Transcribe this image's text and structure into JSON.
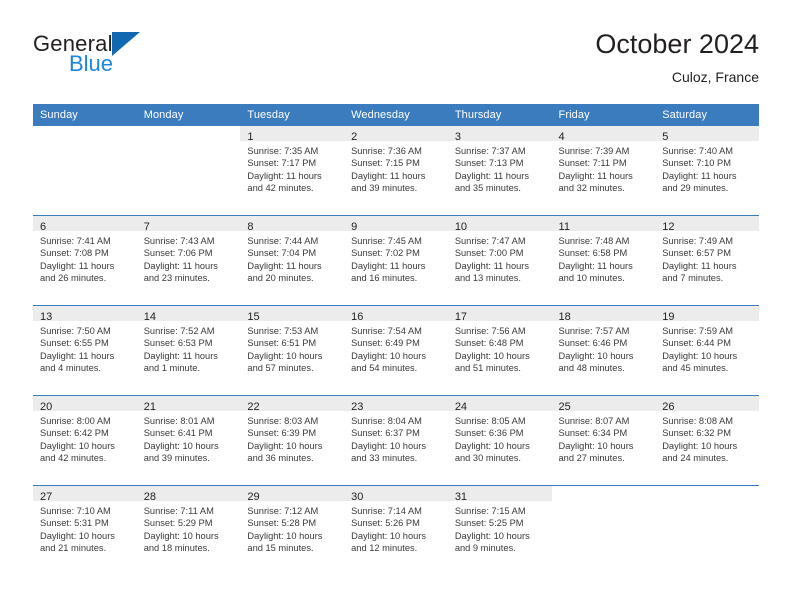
{
  "brand": {
    "name_part1": "General",
    "name_part2": "Blue",
    "triangle_icon": "brand-triangle-icon",
    "accent_color": "#1068b0",
    "blue_color": "#1b86e0"
  },
  "header": {
    "month_title": "October 2024",
    "location": "Culoz, France"
  },
  "theme": {
    "header_band": "#3a7cbe",
    "daynum_band": "#ececec",
    "text": "#231f20"
  },
  "weekday_headers": [
    "Sunday",
    "Monday",
    "Tuesday",
    "Wednesday",
    "Thursday",
    "Friday",
    "Saturday"
  ],
  "weeks": [
    [
      {
        "day": "",
        "empty": true,
        "sunrise": "",
        "sunset": "",
        "daylight_line1": "",
        "daylight_line2": ""
      },
      {
        "day": "",
        "empty": true,
        "sunrise": "",
        "sunset": "",
        "daylight_line1": "",
        "daylight_line2": ""
      },
      {
        "day": "1",
        "empty": false,
        "sunrise": "Sunrise: 7:35 AM",
        "sunset": "Sunset: 7:17 PM",
        "daylight_line1": "Daylight: 11 hours",
        "daylight_line2": "and 42 minutes."
      },
      {
        "day": "2",
        "empty": false,
        "sunrise": "Sunrise: 7:36 AM",
        "sunset": "Sunset: 7:15 PM",
        "daylight_line1": "Daylight: 11 hours",
        "daylight_line2": "and 39 minutes."
      },
      {
        "day": "3",
        "empty": false,
        "sunrise": "Sunrise: 7:37 AM",
        "sunset": "Sunset: 7:13 PM",
        "daylight_line1": "Daylight: 11 hours",
        "daylight_line2": "and 35 minutes."
      },
      {
        "day": "4",
        "empty": false,
        "sunrise": "Sunrise: 7:39 AM",
        "sunset": "Sunset: 7:11 PM",
        "daylight_line1": "Daylight: 11 hours",
        "daylight_line2": "and 32 minutes."
      },
      {
        "day": "5",
        "empty": false,
        "sunrise": "Sunrise: 7:40 AM",
        "sunset": "Sunset: 7:10 PM",
        "daylight_line1": "Daylight: 11 hours",
        "daylight_line2": "and 29 minutes."
      }
    ],
    [
      {
        "day": "6",
        "empty": false,
        "sunrise": "Sunrise: 7:41 AM",
        "sunset": "Sunset: 7:08 PM",
        "daylight_line1": "Daylight: 11 hours",
        "daylight_line2": "and 26 minutes."
      },
      {
        "day": "7",
        "empty": false,
        "sunrise": "Sunrise: 7:43 AM",
        "sunset": "Sunset: 7:06 PM",
        "daylight_line1": "Daylight: 11 hours",
        "daylight_line2": "and 23 minutes."
      },
      {
        "day": "8",
        "empty": false,
        "sunrise": "Sunrise: 7:44 AM",
        "sunset": "Sunset: 7:04 PM",
        "daylight_line1": "Daylight: 11 hours",
        "daylight_line2": "and 20 minutes."
      },
      {
        "day": "9",
        "empty": false,
        "sunrise": "Sunrise: 7:45 AM",
        "sunset": "Sunset: 7:02 PM",
        "daylight_line1": "Daylight: 11 hours",
        "daylight_line2": "and 16 minutes."
      },
      {
        "day": "10",
        "empty": false,
        "sunrise": "Sunrise: 7:47 AM",
        "sunset": "Sunset: 7:00 PM",
        "daylight_line1": "Daylight: 11 hours",
        "daylight_line2": "and 13 minutes."
      },
      {
        "day": "11",
        "empty": false,
        "sunrise": "Sunrise: 7:48 AM",
        "sunset": "Sunset: 6:58 PM",
        "daylight_line1": "Daylight: 11 hours",
        "daylight_line2": "and 10 minutes."
      },
      {
        "day": "12",
        "empty": false,
        "sunrise": "Sunrise: 7:49 AM",
        "sunset": "Sunset: 6:57 PM",
        "daylight_line1": "Daylight: 11 hours",
        "daylight_line2": "and 7 minutes."
      }
    ],
    [
      {
        "day": "13",
        "empty": false,
        "sunrise": "Sunrise: 7:50 AM",
        "sunset": "Sunset: 6:55 PM",
        "daylight_line1": "Daylight: 11 hours",
        "daylight_line2": "and 4 minutes."
      },
      {
        "day": "14",
        "empty": false,
        "sunrise": "Sunrise: 7:52 AM",
        "sunset": "Sunset: 6:53 PM",
        "daylight_line1": "Daylight: 11 hours",
        "daylight_line2": "and 1 minute."
      },
      {
        "day": "15",
        "empty": false,
        "sunrise": "Sunrise: 7:53 AM",
        "sunset": "Sunset: 6:51 PM",
        "daylight_line1": "Daylight: 10 hours",
        "daylight_line2": "and 57 minutes."
      },
      {
        "day": "16",
        "empty": false,
        "sunrise": "Sunrise: 7:54 AM",
        "sunset": "Sunset: 6:49 PM",
        "daylight_line1": "Daylight: 10 hours",
        "daylight_line2": "and 54 minutes."
      },
      {
        "day": "17",
        "empty": false,
        "sunrise": "Sunrise: 7:56 AM",
        "sunset": "Sunset: 6:48 PM",
        "daylight_line1": "Daylight: 10 hours",
        "daylight_line2": "and 51 minutes."
      },
      {
        "day": "18",
        "empty": false,
        "sunrise": "Sunrise: 7:57 AM",
        "sunset": "Sunset: 6:46 PM",
        "daylight_line1": "Daylight: 10 hours",
        "daylight_line2": "and 48 minutes."
      },
      {
        "day": "19",
        "empty": false,
        "sunrise": "Sunrise: 7:59 AM",
        "sunset": "Sunset: 6:44 PM",
        "daylight_line1": "Daylight: 10 hours",
        "daylight_line2": "and 45 minutes."
      }
    ],
    [
      {
        "day": "20",
        "empty": false,
        "sunrise": "Sunrise: 8:00 AM",
        "sunset": "Sunset: 6:42 PM",
        "daylight_line1": "Daylight: 10 hours",
        "daylight_line2": "and 42 minutes."
      },
      {
        "day": "21",
        "empty": false,
        "sunrise": "Sunrise: 8:01 AM",
        "sunset": "Sunset: 6:41 PM",
        "daylight_line1": "Daylight: 10 hours",
        "daylight_line2": "and 39 minutes."
      },
      {
        "day": "22",
        "empty": false,
        "sunrise": "Sunrise: 8:03 AM",
        "sunset": "Sunset: 6:39 PM",
        "daylight_line1": "Daylight: 10 hours",
        "daylight_line2": "and 36 minutes."
      },
      {
        "day": "23",
        "empty": false,
        "sunrise": "Sunrise: 8:04 AM",
        "sunset": "Sunset: 6:37 PM",
        "daylight_line1": "Daylight: 10 hours",
        "daylight_line2": "and 33 minutes."
      },
      {
        "day": "24",
        "empty": false,
        "sunrise": "Sunrise: 8:05 AM",
        "sunset": "Sunset: 6:36 PM",
        "daylight_line1": "Daylight: 10 hours",
        "daylight_line2": "and 30 minutes."
      },
      {
        "day": "25",
        "empty": false,
        "sunrise": "Sunrise: 8:07 AM",
        "sunset": "Sunset: 6:34 PM",
        "daylight_line1": "Daylight: 10 hours",
        "daylight_line2": "and 27 minutes."
      },
      {
        "day": "26",
        "empty": false,
        "sunrise": "Sunrise: 8:08 AM",
        "sunset": "Sunset: 6:32 PM",
        "daylight_line1": "Daylight: 10 hours",
        "daylight_line2": "and 24 minutes."
      }
    ],
    [
      {
        "day": "27",
        "empty": false,
        "sunrise": "Sunrise: 7:10 AM",
        "sunset": "Sunset: 5:31 PM",
        "daylight_line1": "Daylight: 10 hours",
        "daylight_line2": "and 21 minutes."
      },
      {
        "day": "28",
        "empty": false,
        "sunrise": "Sunrise: 7:11 AM",
        "sunset": "Sunset: 5:29 PM",
        "daylight_line1": "Daylight: 10 hours",
        "daylight_line2": "and 18 minutes."
      },
      {
        "day": "29",
        "empty": false,
        "sunrise": "Sunrise: 7:12 AM",
        "sunset": "Sunset: 5:28 PM",
        "daylight_line1": "Daylight: 10 hours",
        "daylight_line2": "and 15 minutes."
      },
      {
        "day": "30",
        "empty": false,
        "sunrise": "Sunrise: 7:14 AM",
        "sunset": "Sunset: 5:26 PM",
        "daylight_line1": "Daylight: 10 hours",
        "daylight_line2": "and 12 minutes."
      },
      {
        "day": "31",
        "empty": false,
        "sunrise": "Sunrise: 7:15 AM",
        "sunset": "Sunset: 5:25 PM",
        "daylight_line1": "Daylight: 10 hours",
        "daylight_line2": "and 9 minutes."
      },
      {
        "day": "",
        "empty": true,
        "sunrise": "",
        "sunset": "",
        "daylight_line1": "",
        "daylight_line2": ""
      },
      {
        "day": "",
        "empty": true,
        "sunrise": "",
        "sunset": "",
        "daylight_line1": "",
        "daylight_line2": ""
      }
    ]
  ]
}
